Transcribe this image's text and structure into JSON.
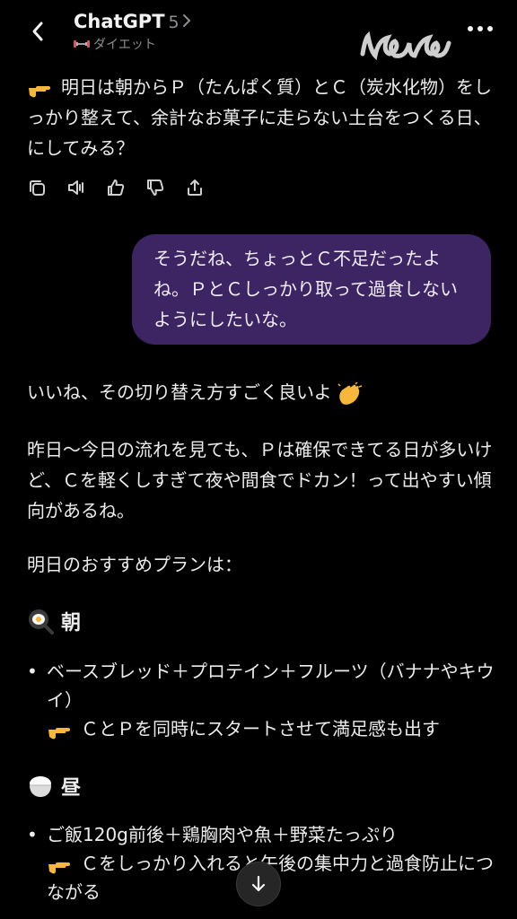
{
  "header": {
    "title": "ChatGPT",
    "version": "5",
    "project": "ダイエット",
    "watermark": "nene"
  },
  "messages": {
    "assistant_top": "明日は朝からＰ（たんぱく質）とＣ（炭水化物）をしっかり整えて、余計なお菓子に走らない土台をつくる日、にしてみる？",
    "user": "そうだね、ちょっとＣ不足だったよね。ＰとＣしっかり取って過食しないようにしたいな。",
    "reply_p1": "いいね、その切り替え方すごく良いよ",
    "reply_p2": "昨日〜今日の流れを見ても、Ｐは確保できてる日が多いけど、Ｃを軽くしすぎて夜や間食でドカン！って出やすい傾向があるね。",
    "reply_p3": "明日のおすすめプランは：",
    "breakfast_heading": "朝",
    "breakfast_item": "ベースブレッド＋プロテイン＋フルーツ（バナナやキウイ）",
    "breakfast_note": "ＣとＰを同時にスタートさせて満足感も出す",
    "lunch_heading": "昼",
    "lunch_item": "ご飯120g前後＋鶏胸肉や魚＋野菜たっぷり",
    "lunch_note": "Ｃをしっかり入れると午後の集中力と過食防止につながる"
  },
  "icons": {
    "back": "chevron-left-icon",
    "more": "more-icon",
    "actions": [
      "copy-icon",
      "speaker-icon",
      "thumbs-up-icon",
      "thumbs-down-icon",
      "share-icon"
    ],
    "scroll": "arrow-down-icon"
  },
  "colors": {
    "background": "#000000",
    "user_bubble": "#3d2463",
    "text": "#ececec",
    "muted": "#8e8e93"
  }
}
